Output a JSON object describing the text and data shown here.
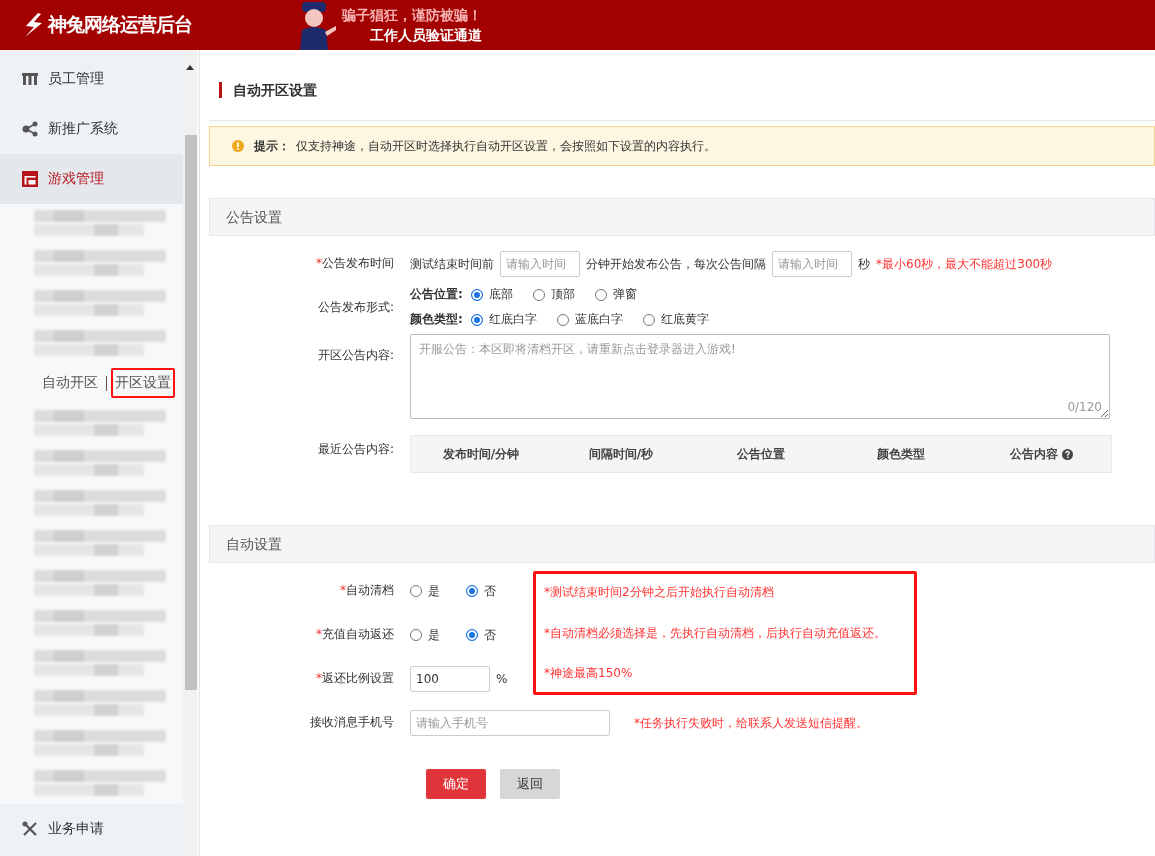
{
  "header": {
    "logo_text": "神兔网络运营后台",
    "banner_lines": [
      "骗子猖狂，谨防被骗！",
      "工作人员验证通道"
    ]
  },
  "sidebar": {
    "items": [
      {
        "label": "员工管理",
        "selected": false
      },
      {
        "label": "新推广系统",
        "selected": false
      },
      {
        "label": "游戏管理",
        "selected": true,
        "expanded": true,
        "children": [
          {
            "kind": "redacted"
          },
          {
            "kind": "redacted"
          },
          {
            "kind": "redacted"
          },
          {
            "kind": "redacted"
          },
          {
            "kind": "links",
            "links": [
              {
                "label": "自动开区",
                "selected": false
              },
              {
                "label": "开区设置",
                "selected": true
              }
            ]
          },
          {
            "kind": "redacted"
          },
          {
            "kind": "redacted"
          },
          {
            "kind": "redacted"
          },
          {
            "kind": "redacted"
          },
          {
            "kind": "redacted"
          },
          {
            "kind": "redacted"
          },
          {
            "kind": "redacted"
          },
          {
            "kind": "redacted"
          },
          {
            "kind": "redacted"
          },
          {
            "kind": "redacted"
          }
        ]
      },
      {
        "label": "业务申请",
        "selected": false
      }
    ]
  },
  "page_title": "自动开区设置",
  "tip": {
    "label": "提示：",
    "text": "仅支持神途，自动开区时选择执行自动开区设置，会按照如下设置的内容执行。"
  },
  "sections": [
    {
      "title": "公告设置",
      "rows": [
        {
          "mark": "*",
          "label": "公告发布时间",
          "kind": "inline",
          "parts": [
            {
              "kind": "text",
              "text": "测试结束时间前"
            },
            {
              "kind": "input",
              "placeholder": "请输入时间"
            },
            {
              "kind": "text",
              "text": "分钟开始发布公告，每次公告间隔"
            },
            {
              "kind": "input",
              "placeholder": "请输入时间"
            },
            {
              "kind": "text",
              "text": "秒"
            },
            {
              "kind": "hint",
              "text": "*最小60秒，最大不能超过300秒"
            }
          ]
        },
        {
          "label": "公告发布形式:",
          "kind": "radiogroups",
          "groups": [
            {
              "label": "公告位置:",
              "options": [
                {
                  "label": "底部",
                  "selected": true
                },
                {
                  "label": "顶部",
                  "selected": false
                },
                {
                  "label": "弹窗",
                  "selected": false
                }
              ]
            },
            {
              "label": "颜色类型:",
              "options": [
                {
                  "label": "红底白字",
                  "selected": true
                },
                {
                  "label": "蓝底白字",
                  "selected": false
                },
                {
                  "label": "红底黄字",
                  "selected": false
                }
              ]
            }
          ]
        },
        {
          "label": "开区公告内容:",
          "kind": "textarea",
          "placeholder": "开服公告：本区即将清档开区，请重新点击登录器进入游戏!",
          "counter": "0/120"
        },
        {
          "label": "最近公告内容:",
          "kind": "table",
          "columns": [
            "发布时间/分钟",
            "间隔时间/秒",
            "公告位置",
            "颜色类型",
            "公告内容"
          ]
        }
      ]
    },
    {
      "title": "自动设置",
      "notes": [
        "*测试结束时间2分钟之后开始执行自动清档",
        "*自动清档必须选择是，先执行自动清档，后执行自动充值返还。",
        "*神途最高150%"
      ],
      "rows": [
        {
          "mark": "*",
          "label": "自动清档",
          "kind": "radios",
          "options": [
            {
              "label": "是",
              "selected": false
            },
            {
              "label": "否",
              "selected": true
            }
          ]
        },
        {
          "mark": "*",
          "label": "充值自动返还",
          "kind": "radios",
          "options": [
            {
              "label": "是",
              "selected": false
            },
            {
              "label": "否",
              "selected": true
            }
          ]
        },
        {
          "mark": "*",
          "label": "返还比例设置",
          "kind": "inline",
          "parts": [
            {
              "kind": "input",
              "value": "100"
            },
            {
              "kind": "text",
              "text": "%"
            }
          ]
        },
        {
          "label": "接收消息手机号",
          "kind": "inline",
          "parts": [
            {
              "kind": "wide_input",
              "placeholder": "请输入手机号"
            },
            {
              "kind": "hint",
              "text": "*任务执行失败时，给联系人发送短信提醒。"
            }
          ]
        }
      ]
    }
  ],
  "buttons": [
    {
      "label": "确定",
      "kind": "primary"
    },
    {
      "label": "返回",
      "kind": "secondary"
    }
  ]
}
